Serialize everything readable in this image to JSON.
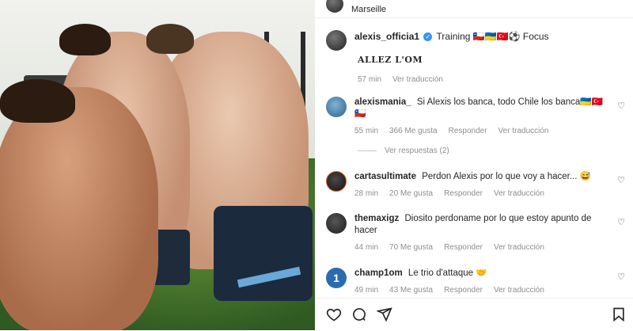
{
  "post_header": {
    "location": "Marseille"
  },
  "caption": {
    "username": "alexis_officia1",
    "text": "Training 🇨🇱🇺🇦🇹🇷⚽ Focus",
    "line2": "ALLEZ L'OM",
    "time": "57 min",
    "translate": "Ver traducción"
  },
  "comments": [
    {
      "username": "alexismania_",
      "text": "Si Alexis los banca, todo Chile los banca🇺🇦🇹🇷🇨🇱",
      "time": "55 min",
      "likes": "366 Me gusta",
      "reply": "Responder",
      "translate": "Ver traducción"
    },
    {
      "username": "cartasultimate",
      "text": "Perdon Alexis por lo que voy a hacer... 😅",
      "time": "28 min",
      "likes": "20 Me gusta",
      "reply": "Responder",
      "translate": "Ver traducción"
    },
    {
      "username": "themaxigz",
      "text": "Diosito perdoname por lo que estoy apunto de hacer",
      "time": "44 min",
      "likes": "70 Me gusta",
      "reply": "Responder",
      "translate": "Ver traducción"
    },
    {
      "username": "champ1om",
      "text": "Le trio d'attaque 🤝",
      "time": "49 min",
      "likes": "43 Me gusta",
      "reply": "Responder",
      "translate": "Ver traducción"
    }
  ],
  "view_replies": "Ver respuestas (2)",
  "icons": {
    "like": "heart-icon",
    "comment": "comment-icon",
    "share": "send-icon",
    "save": "bookmark-icon"
  }
}
